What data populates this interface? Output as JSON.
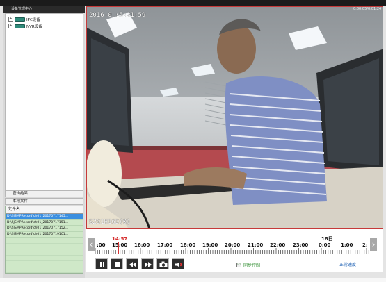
{
  "left_panel": {
    "title": "设备管理中心",
    "tree": [
      {
        "label": "IPC设备",
        "expander": "+"
      },
      {
        "label": "NVR设备",
        "expander": "+"
      }
    ],
    "query_tab": "查询结果",
    "local_tab": "本地文件",
    "file_header": "文件名",
    "files": [
      "D:\\SJSMPRecord\\ch01_20170717145...",
      "D:\\SJSMPRecord\\ch01_20170717151...",
      "D:\\SJSMPRecord\\ch01_20170717152...",
      "D:\\SJSMPRecord\\ch01_20170719101..."
    ]
  },
  "video": {
    "osd_date": "2016-0   :5:21:59",
    "osd_camera": "S291H16D(0)",
    "play_time": "0:00:05/0:01:24"
  },
  "timeline": {
    "current_time": "14:57",
    "day_marker": "18日",
    "hours": [
      ":00",
      "15:00",
      "16:00",
      "17:00",
      "18:00",
      "19:00",
      "20:00",
      "21:00",
      "22:00",
      "23:00",
      "0:00",
      "1:00",
      "2:"
    ]
  },
  "controls": {
    "sync_check": "☑",
    "sync_label": "同步控制",
    "speed_label": "正常速度"
  },
  "colors": {
    "accent_red": "#d63030",
    "file_bg": "#cfe8c8",
    "selected": "#3b8fe0",
    "sync_green": "#2a8a2a",
    "speed_blue": "#1b5fb3"
  },
  "icons": {
    "pause": "pause-icon",
    "stop": "stop-icon",
    "rewind": "rewind-icon",
    "fast_forward": "fast-forward-icon",
    "snapshot": "camera-icon",
    "audio": "speaker-icon"
  }
}
